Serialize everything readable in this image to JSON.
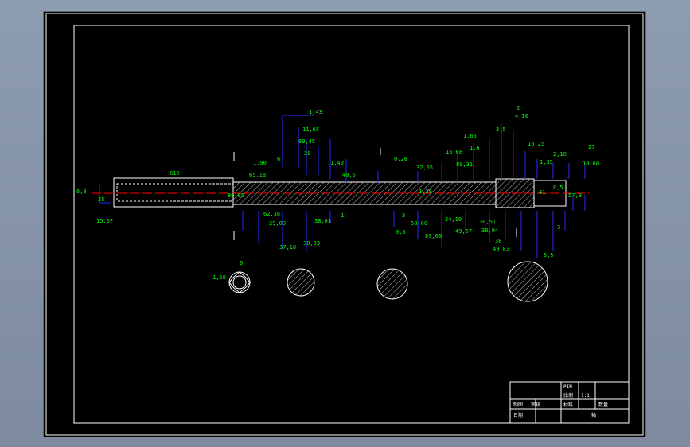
{
  "dimensions": {
    "top_stack": [
      "1,43",
      "11,65",
      "89,45",
      "20",
      "1,40",
      "40,5",
      "1,90",
      "65,18",
      "6",
      "619",
      "6,8",
      "25",
      "15,07",
      "1,38",
      "80,85"
    ],
    "mid_labels": [
      "0,28",
      "16,68",
      "1,6",
      "1,66",
      "32,65",
      "89,31",
      "3,5",
      "4,10",
      "2",
      "16,25",
      "2,18",
      "1,35",
      "10,60",
      "27"
    ],
    "bottom_labels": [
      "62,38",
      "29,09",
      "37,18",
      "30,33",
      "38,61",
      "1",
      "3",
      "0,6",
      "58,60",
      "89,00",
      "34,19",
      "49,57",
      "30,51",
      "38,04",
      "38",
      "49,83",
      "3",
      "0,5",
      "41",
      "57,8"
    ],
    "section_labels": [
      "6",
      "1,60",
      "5,5"
    ]
  },
  "title_block": {
    "rows": [
      [
        "PIN",
        ""
      ],
      [
        "比例",
        "1:1"
      ],
      [
        "材料",
        "",
        "数量"
      ],
      [
        "制图",
        "审核",
        "日期"
      ]
    ],
    "part_name": "轴"
  },
  "colors": {
    "background": "#000000",
    "outline": "#ffffff",
    "dimension": "#2a2aff",
    "dimension_text": "#00ff00",
    "centerline": "#ff0000"
  }
}
